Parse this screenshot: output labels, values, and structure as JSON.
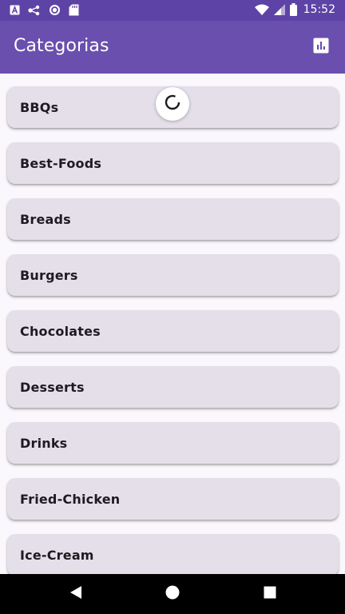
{
  "status_bar": {
    "time": "15:52",
    "icons": [
      "notification-a-icon",
      "signal-dots-icon",
      "sync-circle-icon",
      "sd-card-icon",
      "wifi-icon",
      "cell-signal-icon",
      "battery-icon"
    ]
  },
  "app_bar": {
    "title": "Categorias",
    "action_icon": "bar-chart-icon"
  },
  "categories": [
    {
      "label": "BBQs"
    },
    {
      "label": "Best-Foods"
    },
    {
      "label": "Breads"
    },
    {
      "label": "Burgers"
    },
    {
      "label": "Chocolates"
    },
    {
      "label": "Desserts"
    },
    {
      "label": "Drinks"
    },
    {
      "label": "Fried-Chicken"
    },
    {
      "label": "Ice-Cream"
    }
  ],
  "nav_bar": {
    "buttons": [
      "back-icon",
      "home-icon",
      "recents-icon"
    ]
  },
  "colors": {
    "status_bar": "#5E43A6",
    "app_bar": "#6A4FAE",
    "card": "#E5DFEA",
    "background": "#FAF8FD"
  }
}
